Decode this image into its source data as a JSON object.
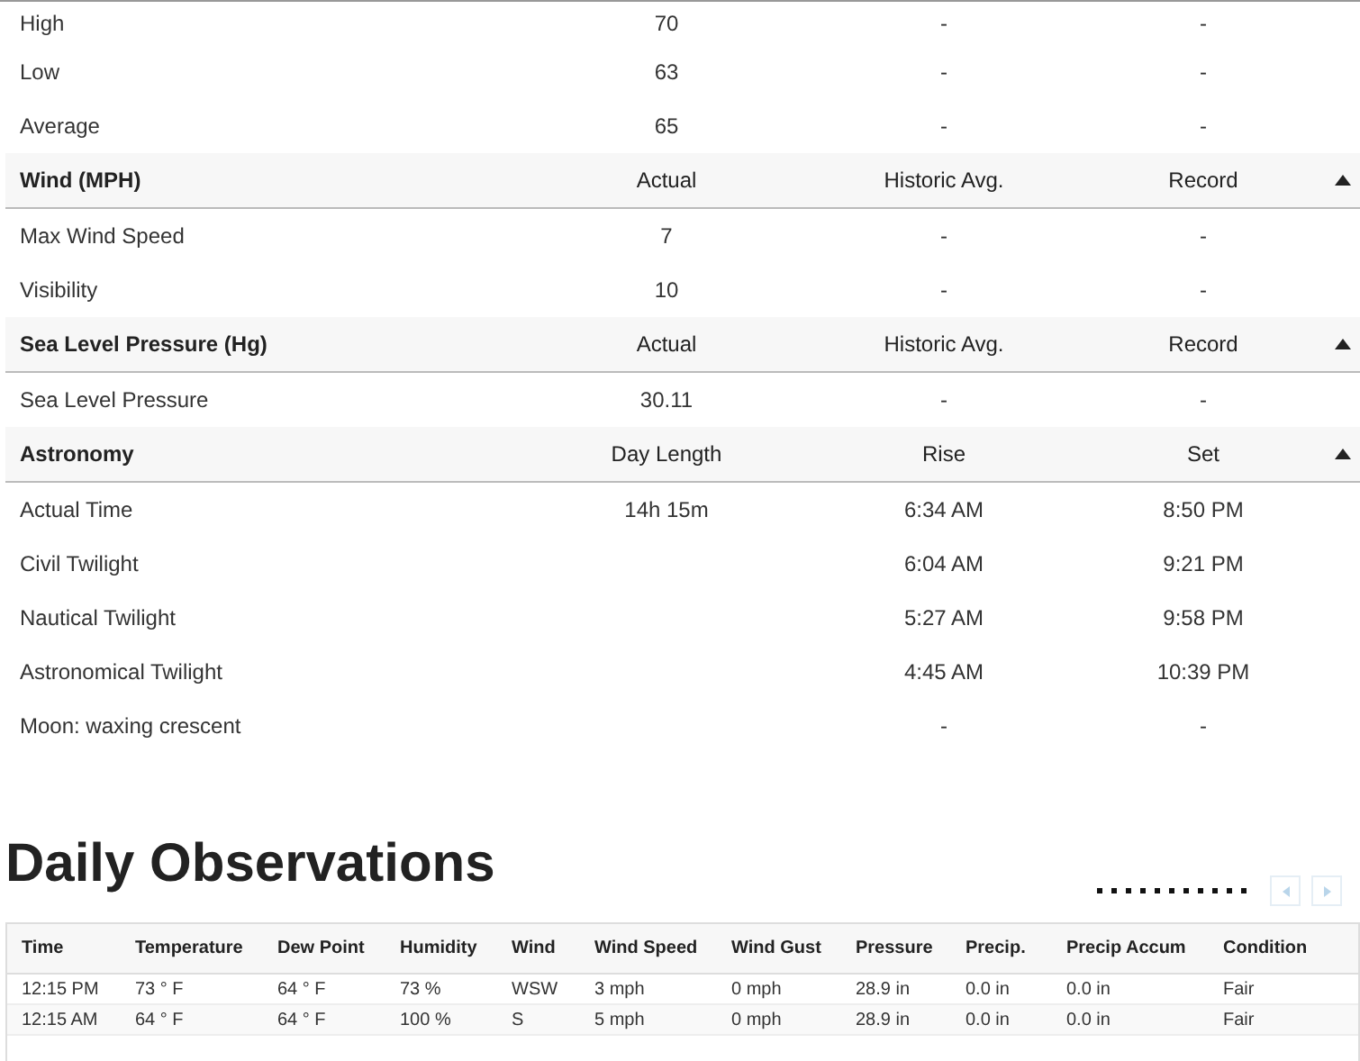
{
  "summary_sections": [
    {
      "rows": [
        {
          "label": "High",
          "column_2": "70",
          "column_3": "-",
          "column_4": "-"
        },
        {
          "label": "Low",
          "column_2": "63",
          "column_3": "-",
          "column_4": "-"
        },
        {
          "label": "Average",
          "column_2": "65",
          "column_3": "-",
          "column_4": "-"
        }
      ]
    },
    {
      "title": "Wind (MPH)",
      "columns": [
        "Actual",
        "Historic Avg.",
        "Record"
      ],
      "expanded": true,
      "rows": [
        {
          "label": "Max Wind Speed",
          "column_2": "7",
          "column_3": "-",
          "column_4": "-"
        },
        {
          "label": "Visibility",
          "column_2": "10",
          "column_3": "-",
          "column_4": "-"
        }
      ]
    },
    {
      "title": "Sea Level Pressure (Hg)",
      "columns": [
        "Actual",
        "Historic Avg.",
        "Record"
      ],
      "expanded": true,
      "rows": [
        {
          "label": "Sea Level Pressure",
          "column_2": "30.11",
          "column_3": "-",
          "column_4": "-"
        }
      ]
    },
    {
      "title": "Astronomy",
      "columns": [
        "Day Length",
        "Rise",
        "Set"
      ],
      "expanded": true,
      "rows": [
        {
          "label": "Actual Time",
          "column_2": "14h 15m",
          "column_3": "6:34 AM",
          "column_4": "8:50 PM"
        },
        {
          "label": "Civil Twilight",
          "column_3": "6:04 AM",
          "column_4": "9:21 PM"
        },
        {
          "label": "Nautical Twilight",
          "column_3": "5:27 AM",
          "column_4": "9:58 PM"
        },
        {
          "label": "Astronomical Twilight",
          "column_3": "4:45 AM",
          "column_4": "10:39 PM"
        },
        {
          "label": "Moon: waxing crescent",
          "column_3": "-",
          "column_4": "-"
        }
      ]
    }
  ],
  "daily_observations": {
    "title": "Daily Observations",
    "columns": [
      "Time",
      "Temperature",
      "Dew Point",
      "Humidity",
      "Wind",
      "Wind Speed",
      "Wind Gust",
      "Pressure",
      "Precip.",
      "Precip Accum",
      "Condition"
    ],
    "rows": [
      [
        "12:15 PM",
        "73 ° F",
        "64 ° F",
        "73 %",
        "WSW",
        "3 mph",
        "0 mph",
        "28.9 in",
        "0.0 in",
        "0.0 in",
        "Fair"
      ],
      [
        "12:15 AM",
        "64 ° F",
        "64 ° F",
        "100 %",
        "S",
        "5 mph",
        "0 mph",
        "28.9 in",
        "0.0 in",
        "0.0 in",
        "Fair"
      ]
    ]
  }
}
